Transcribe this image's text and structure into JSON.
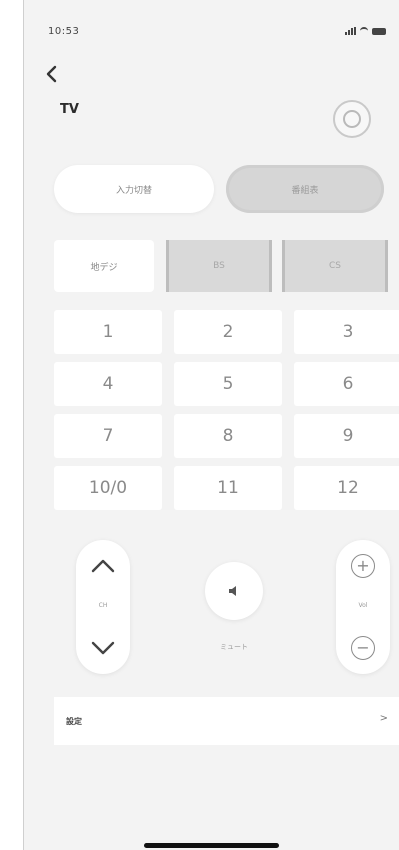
{
  "status_bar": {
    "time": "10:53"
  },
  "header": {
    "title": "TV"
  },
  "mode_toggle": {
    "left_label": "入力切替",
    "right_label": "番組表"
  },
  "input_row": {
    "first": "地デジ",
    "second": "BS",
    "third": "CS"
  },
  "keypad": {
    "keys": [
      "1",
      "2",
      "3",
      "4",
      "5",
      "6",
      "7",
      "8",
      "9",
      "10/0",
      "11",
      "12"
    ]
  },
  "controls": {
    "channel_label": "CH",
    "mute_label": "ミュート",
    "volume_label": "Vol"
  },
  "settings_row": {
    "label": "設定",
    "chevron": ">"
  }
}
